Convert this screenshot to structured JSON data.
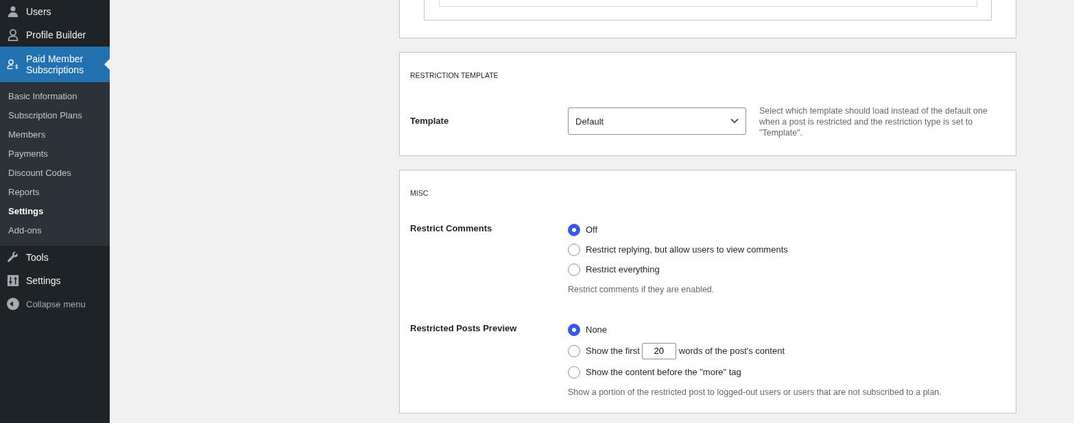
{
  "sidebar": {
    "items": [
      {
        "label": "Users",
        "selected": false
      },
      {
        "label": "Profile Builder",
        "selected": false
      },
      {
        "label": "Paid Member Subscriptions",
        "selected": true,
        "children": [
          {
            "label": "Basic Information",
            "selected": false
          },
          {
            "label": "Subscription Plans",
            "selected": false
          },
          {
            "label": "Members",
            "selected": false
          },
          {
            "label": "Payments",
            "selected": false
          },
          {
            "label": "Discount Codes",
            "selected": false
          },
          {
            "label": "Reports",
            "selected": false
          },
          {
            "label": "Settings",
            "selected": true
          },
          {
            "label": "Add-ons",
            "selected": false
          }
        ]
      },
      {
        "label": "Tools",
        "selected": false
      },
      {
        "label": "Settings",
        "selected": false
      }
    ],
    "collapse": "Collapse menu"
  },
  "sections": [
    {
      "title": "RESTRICTION TEMPLATE",
      "fields": [
        {
          "kind": "select",
          "label": "Template",
          "value": "Default",
          "description": "Select which template should load instead of the default one when a post is restricted and the restriction type is set to \"Template\"."
        }
      ]
    },
    {
      "title": "MISC",
      "fields": [
        {
          "kind": "radio",
          "label": "Restrict Comments",
          "options": [
            {
              "kind": "plain",
              "label": "Off",
              "selected": true
            },
            {
              "kind": "plain",
              "label": "Restrict replying, but allow users to view comments",
              "selected": false
            },
            {
              "kind": "plain",
              "label": "Restrict everything",
              "selected": false
            }
          ],
          "description": "Restrict comments if they are enabled."
        },
        {
          "kind": "radio",
          "label": "Restricted Posts Preview",
          "options": [
            {
              "kind": "plain",
              "label": "None",
              "selected": true
            },
            {
              "kind": "with-input",
              "before": "Show the first",
              "value": "20",
              "after": "words of the post's content",
              "selected": false
            },
            {
              "kind": "plain",
              "label": "Show the content before the \"more\" tag",
              "selected": false
            }
          ],
          "description": "Show a portion of the restricted post to logged-out users or users that are not subscribed to a plan."
        }
      ]
    }
  ]
}
